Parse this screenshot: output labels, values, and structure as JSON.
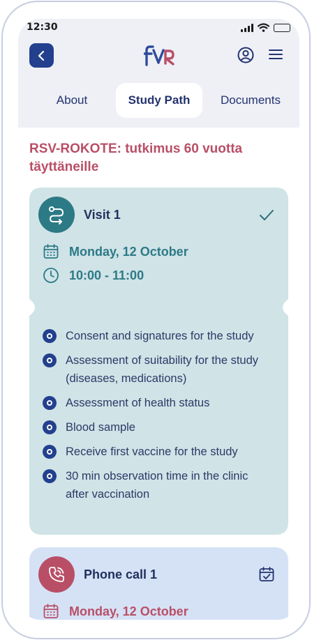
{
  "status_bar": {
    "time": "12:30"
  },
  "header": {
    "back_icon": "chevron-left-icon",
    "logo_text": "fvr",
    "account_icon": "account-circle-icon",
    "menu_icon": "hamburger-menu-icon",
    "colors": {
      "accent": "#23408e",
      "brand_pink": "#b94f66",
      "brand_blue": "#2f4c9c"
    }
  },
  "tabs": [
    {
      "label": "About",
      "active": false
    },
    {
      "label": "Study Path",
      "active": true
    },
    {
      "label": "Documents",
      "active": false
    }
  ],
  "study": {
    "title": "RSV-ROKOTE: tutkimus 60 vuotta täyttäneille"
  },
  "visit": {
    "title": "Visit 1",
    "icon": "route-icon",
    "status_icon": "checkmark-icon",
    "date": "Monday, 12 October",
    "time": "10:00 - 11:00",
    "color": "#d0e3e7",
    "accent": "#2c7a86",
    "tasks": [
      {
        "label": "Consent and signatures for the study"
      },
      {
        "label": "Assessment of suitability for the study (diseases, medications)"
      },
      {
        "label": "Assessment of health status"
      },
      {
        "label": "Blood sample"
      },
      {
        "label": "Receive first vaccine for the study"
      },
      {
        "label": "30 min observation time in the clinic after vaccination"
      }
    ]
  },
  "phone_call": {
    "title": "Phone call 1",
    "icon": "phone-icon",
    "status_icon": "calendar-check-icon",
    "date": "Monday, 12 October",
    "color": "#d5e2f6",
    "accent": "#b94f66"
  }
}
